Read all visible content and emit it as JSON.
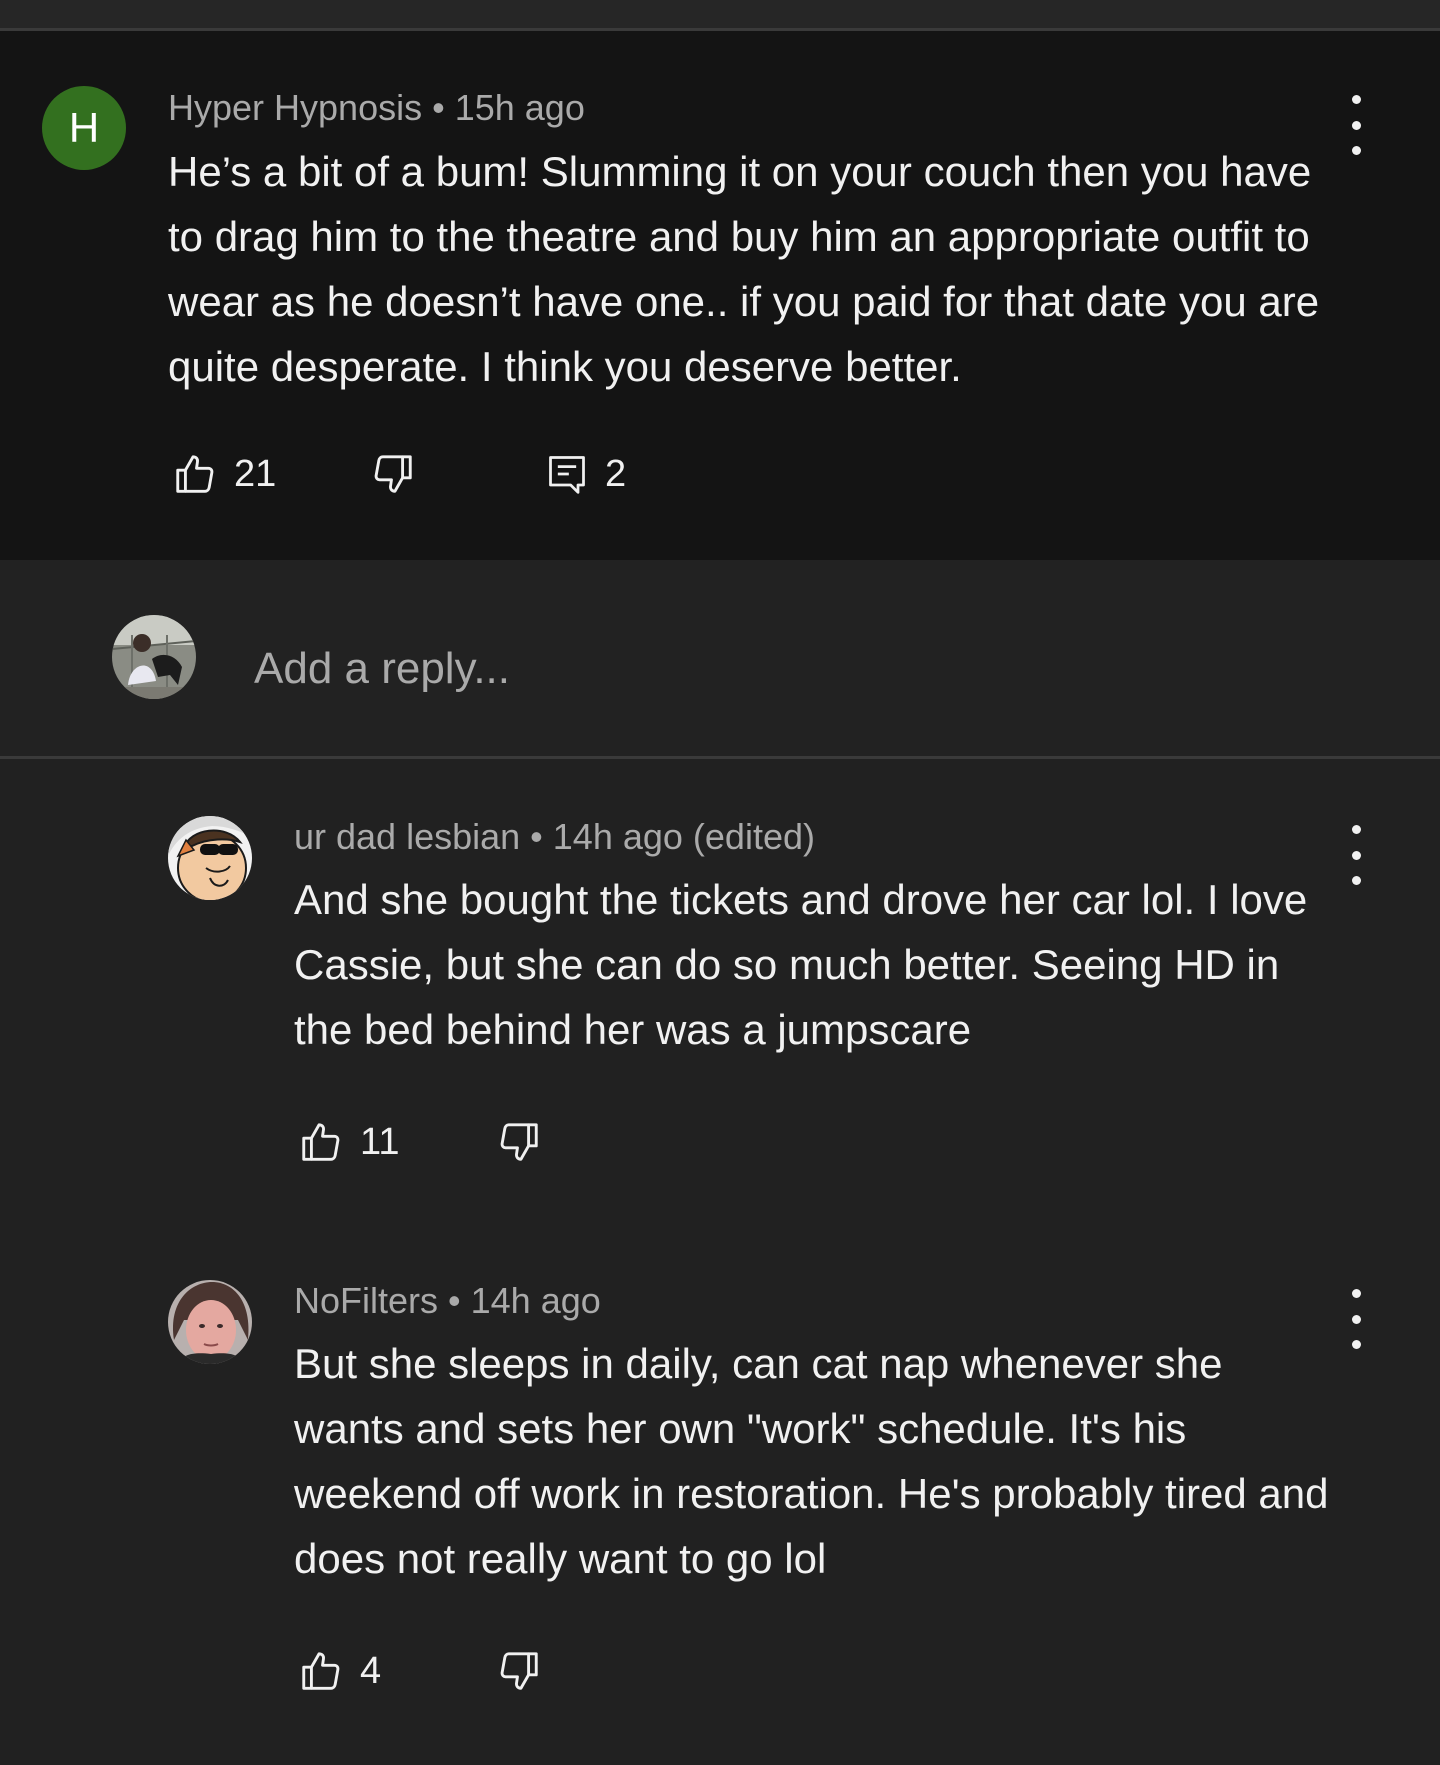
{
  "colors": {
    "background": "#212121",
    "parent_background": "#141414",
    "avatar_h": "#33701f",
    "meta_text": "#aaaaaa",
    "body_text": "#f1f1f1"
  },
  "parent_comment": {
    "avatar_letter": "H",
    "author": "Hyper Hypnosis",
    "separator": "•",
    "time": "15h ago",
    "text": "He’s a bit of a bum! Slumming it on your couch then you have to drag him to the theatre and buy him an appropriate outfit to wear as he doesn’t have one.. if you paid for that date you are quite desperate. I think you deserve better.",
    "likes": "21",
    "replies_count": "2",
    "icons": [
      "thumbs-up-icon",
      "thumbs-down-icon",
      "comment-icon",
      "more-vert-icon"
    ]
  },
  "reply_box": {
    "placeholder": "Add a reply..."
  },
  "replies": [
    {
      "author": "ur dad lesbian",
      "separator": "•",
      "time": "14h ago (edited)",
      "text": "And she bought the tickets and drove her car lol. I love Cassie, but she can do so much better. Seeing HD in the bed behind her was a jumpscare",
      "likes": "11"
    },
    {
      "author": "NoFilters",
      "separator": "•",
      "time": "14h ago",
      "text": "But she sleeps in daily, can cat nap whenever she wants and sets her own \"work\" schedule. It's his weekend off work in restoration. He's probably tired and does not really want to go lol",
      "likes": "4"
    }
  ]
}
